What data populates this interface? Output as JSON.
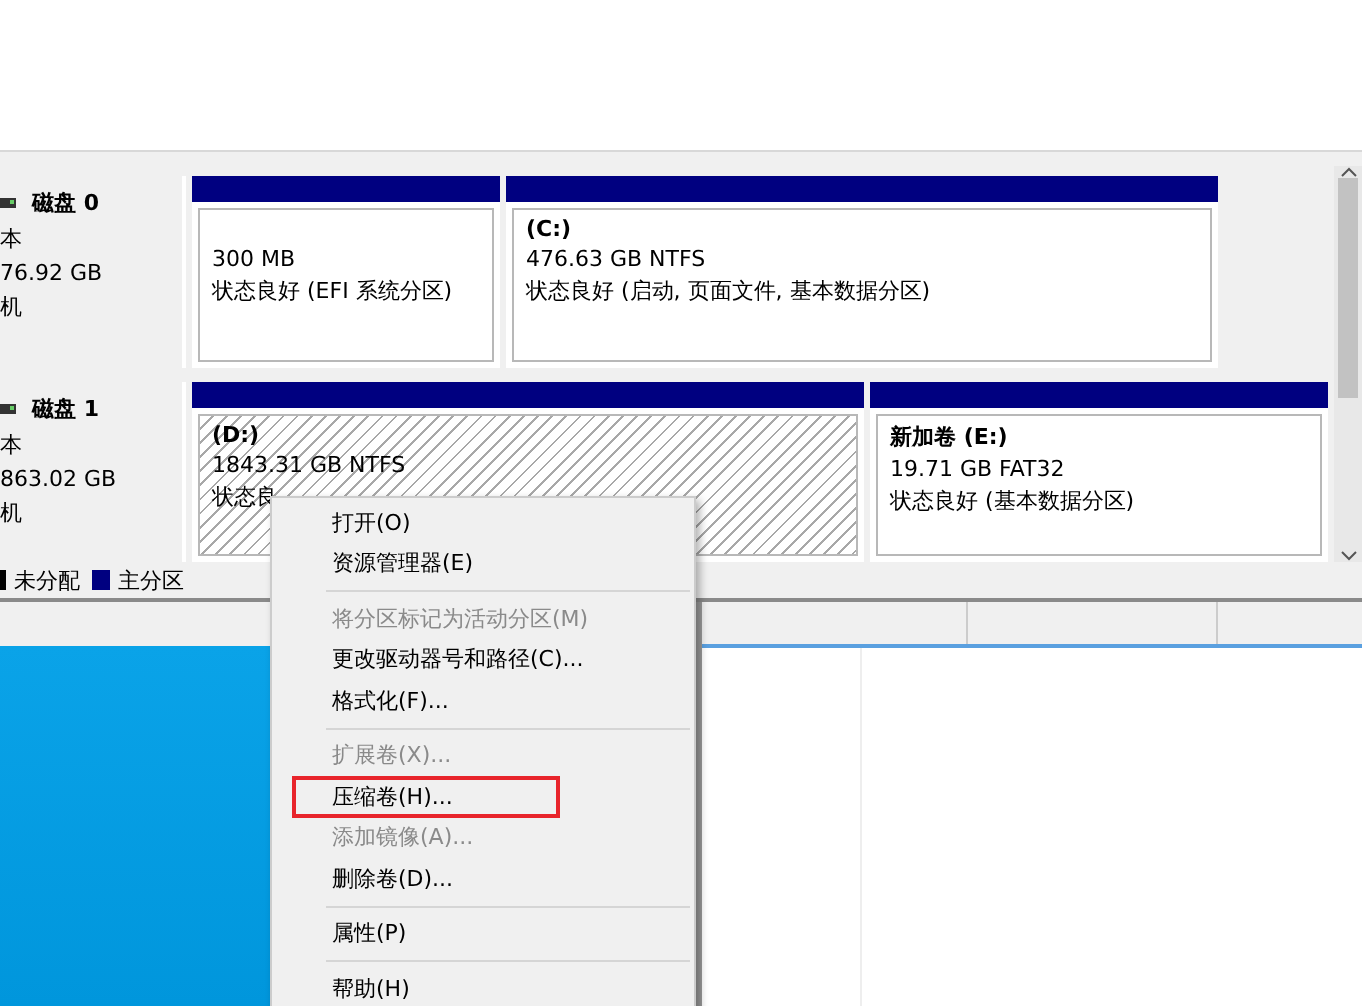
{
  "disks": [
    {
      "name": "磁盘 0",
      "type": "本",
      "size": "76.92 GB",
      "status": "机",
      "partitions": [
        {
          "size": "300 MB",
          "status": "状态良好 (EFI 系统分区)",
          "selected": false
        },
        {
          "label": "(C:)",
          "size": "476.63 GB NTFS",
          "status": "状态良好 (启动, 页面文件, 基本数据分区)",
          "selected": false
        }
      ]
    },
    {
      "name": "磁盘 1",
      "type": "本",
      "size": "863.02 GB",
      "status": "机",
      "partitions": [
        {
          "label": "(D:)",
          "size": "1843.31 GB NTFS",
          "status": "状态良",
          "selected": true
        },
        {
          "label": "新加卷 (E:)",
          "size": "19.71 GB FAT32",
          "status": "状态良好 (基本数据分区)",
          "selected": false
        }
      ]
    }
  ],
  "legend": [
    {
      "label": "未分配",
      "color": "#000000"
    },
    {
      "label": "主分区",
      "color": "#000080"
    }
  ],
  "context_menu": [
    {
      "kind": "item",
      "label": "打开(O)",
      "disabled": false,
      "highlighted": false
    },
    {
      "kind": "item",
      "label": "资源管理器(E)",
      "disabled": false,
      "highlighted": false
    },
    {
      "kind": "separator"
    },
    {
      "kind": "item",
      "label": "将分区标记为活动分区(M)",
      "disabled": true,
      "highlighted": false
    },
    {
      "kind": "item",
      "label": "更改驱动器号和路径(C)...",
      "disabled": false,
      "highlighted": false
    },
    {
      "kind": "item",
      "label": "格式化(F)...",
      "disabled": false,
      "highlighted": false
    },
    {
      "kind": "separator"
    },
    {
      "kind": "item",
      "label": "扩展卷(X)...",
      "disabled": true,
      "highlighted": false
    },
    {
      "kind": "item",
      "label": "压缩卷(H)...",
      "disabled": false,
      "highlighted": true
    },
    {
      "kind": "item",
      "label": "添加镜像(A)...",
      "disabled": true,
      "highlighted": false
    },
    {
      "kind": "item",
      "label": "删除卷(D)...",
      "disabled": false,
      "highlighted": false
    },
    {
      "kind": "separator"
    },
    {
      "kind": "item",
      "label": "属性(P)",
      "disabled": false,
      "highlighted": false
    },
    {
      "kind": "separator"
    },
    {
      "kind": "item",
      "label": "帮助(H)",
      "disabled": false,
      "highlighted": false
    }
  ]
}
